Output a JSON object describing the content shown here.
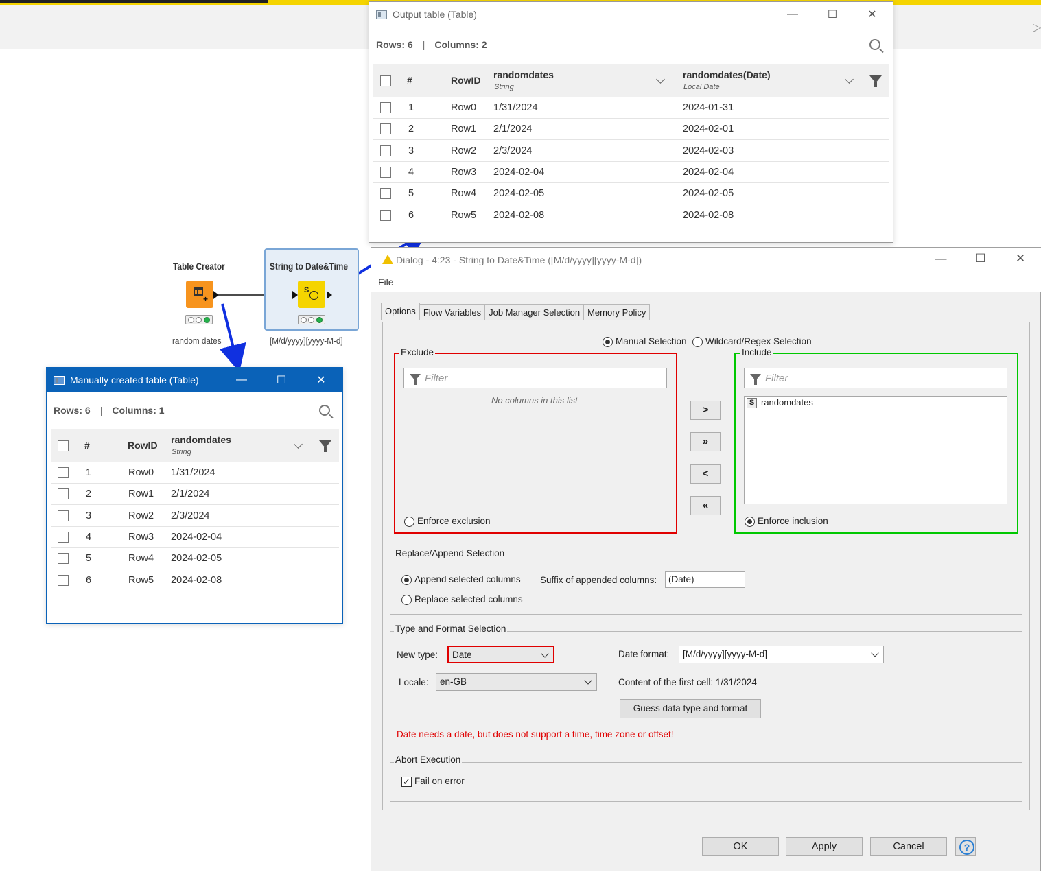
{
  "workflow": {
    "node1": {
      "name": "Table Creator",
      "label": "random dates"
    },
    "node2": {
      "name": "String to Date&Time",
      "label": "[M/d/yyyy][yyyy-M-d]"
    }
  },
  "output_table": {
    "title": "Output table (Table)",
    "rows_label": "Rows: 6",
    "sep": "|",
    "cols_label": "Columns: 2",
    "headers": {
      "num": "#",
      "rowid": "RowID",
      "col1": "randomdates",
      "col1_type": "String",
      "col2": "randomdates(Date)",
      "col2_type": "Local Date"
    },
    "rows": [
      {
        "n": "1",
        "id": "Row0",
        "a": "1/31/2024",
        "b": "2024-01-31"
      },
      {
        "n": "2",
        "id": "Row1",
        "a": "2/1/2024",
        "b": "2024-02-01"
      },
      {
        "n": "3",
        "id": "Row2",
        "a": "2/3/2024",
        "b": "2024-02-03"
      },
      {
        "n": "4",
        "id": "Row3",
        "a": "2024-02-04",
        "b": "2024-02-04"
      },
      {
        "n": "5",
        "id": "Row4",
        "a": "2024-02-05",
        "b": "2024-02-05"
      },
      {
        "n": "6",
        "id": "Row5",
        "a": "2024-02-08",
        "b": "2024-02-08"
      }
    ]
  },
  "input_table": {
    "title": "Manually created table (Table)",
    "rows_label": "Rows: 6",
    "sep": "|",
    "cols_label": "Columns: 1",
    "headers": {
      "num": "#",
      "rowid": "RowID",
      "col1": "randomdates",
      "col1_type": "String"
    },
    "rows": [
      {
        "n": "1",
        "id": "Row0",
        "a": "1/31/2024"
      },
      {
        "n": "2",
        "id": "Row1",
        "a": "2/1/2024"
      },
      {
        "n": "3",
        "id": "Row2",
        "a": "2/3/2024"
      },
      {
        "n": "4",
        "id": "Row3",
        "a": "2024-02-04"
      },
      {
        "n": "5",
        "id": "Row4",
        "a": "2024-02-05"
      },
      {
        "n": "6",
        "id": "Row5",
        "a": "2024-02-08"
      }
    ]
  },
  "dialog": {
    "title": "Dialog - 4:23 - String to Date&Time ([M/d/yyyy][yyyy-M-d])",
    "menu_file": "File",
    "tabs": [
      "Options",
      "Flow Variables",
      "Job Manager Selection",
      "Memory Policy"
    ],
    "manual_selection": "Manual Selection",
    "wildcard_selection": "Wildcard/Regex Selection",
    "exclude_title": "Exclude",
    "include_title": "Include",
    "filter_placeholder": "Filter",
    "no_columns": "No columns in this list",
    "include_item_type": "S",
    "include_item": "randomdates",
    "enforce_exclusion": "Enforce exclusion",
    "enforce_inclusion": "Enforce inclusion",
    "move_buttons": [
      ">",
      "»",
      "<",
      "«"
    ],
    "replace_group_title": "Replace/Append Selection",
    "append_label": "Append selected columns",
    "replace_label": "Replace selected columns",
    "suffix_label": "Suffix of appended columns:",
    "suffix_value": "(Date)",
    "type_group_title": "Type and Format Selection",
    "new_type_label": "New type:",
    "new_type_value": "Date",
    "date_format_label": "Date format:",
    "date_format_value": "[M/d/yyyy][yyyy-M-d]",
    "locale_label": "Locale:",
    "locale_value": "en-GB",
    "first_cell_label": "Content of the first cell: 1/31/2024",
    "guess_button": "Guess data type and format",
    "error_text": "Date needs a date, but does not support a time, time zone or offset!",
    "abort_group_title": "Abort Execution",
    "fail_on_error": "Fail on error",
    "ok": "OK",
    "apply": "Apply",
    "cancel": "Cancel"
  },
  "colors": {
    "accent_blue": "#0a62b8",
    "exclude_border": "#e00000",
    "include_border": "#00c800",
    "error_text": "#e00000",
    "node_orange": "#f7941e",
    "node_yellow": "#f5d400"
  }
}
